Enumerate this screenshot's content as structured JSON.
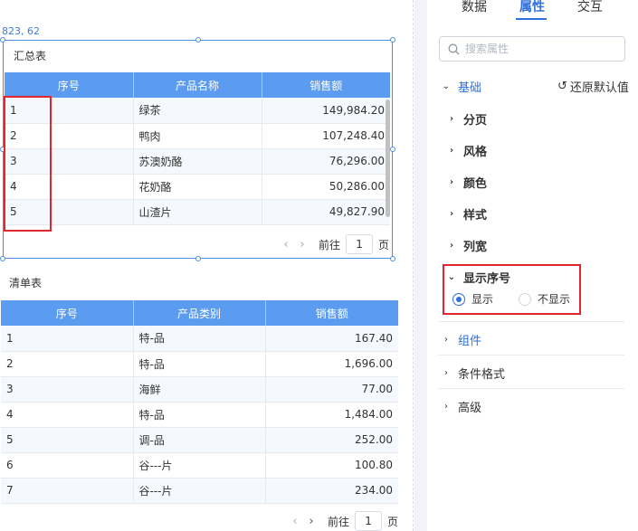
{
  "canvas": {
    "coord_readout": "823, 62",
    "summary": {
      "title": "汇总表",
      "columns": [
        "序号",
        "产品名称",
        "销售额"
      ],
      "rows": [
        [
          "1",
          "绿茶",
          "149,984.20"
        ],
        [
          "2",
          "鸭肉",
          "107,248.40"
        ],
        [
          "3",
          "苏澳奶酪",
          "76,296.00"
        ],
        [
          "4",
          "花奶酪",
          "50,286.00"
        ],
        [
          "5",
          "山渣片",
          "49,827.90"
        ]
      ],
      "pager": {
        "goto_label": "前往",
        "page": "1",
        "page_unit": "页"
      }
    },
    "detail": {
      "title": "清单表",
      "columns": [
        "序号",
        "产品类别",
        "销售额"
      ],
      "rows": [
        [
          "1",
          "特-品",
          "167.40"
        ],
        [
          "2",
          "特-品",
          "1,696.00"
        ],
        [
          "3",
          "海鲜",
          "77.00"
        ],
        [
          "4",
          "特-品",
          "1,484.00"
        ],
        [
          "5",
          "调-品",
          "252.00"
        ],
        [
          "6",
          "谷---片",
          "100.80"
        ],
        [
          "7",
          "谷---片",
          "234.00"
        ]
      ],
      "pager": {
        "goto_label": "前往",
        "page": "1",
        "page_unit": "页"
      }
    }
  },
  "panel": {
    "tabs": [
      {
        "label": "数据",
        "active": false
      },
      {
        "label": "属性",
        "active": true
      },
      {
        "label": "交互",
        "active": false
      }
    ],
    "search_placeholder": "搜索属性",
    "basic": {
      "label": "基础",
      "reset_label": "还原默认值"
    },
    "basic_items": [
      "分页",
      "风格",
      "颜色",
      "样式",
      "列宽"
    ],
    "show_index": {
      "label": "显示序号",
      "options": [
        {
          "label": "显示",
          "selected": true
        },
        {
          "label": "不显示",
          "selected": false
        }
      ]
    },
    "sections": [
      "组件",
      "条件格式",
      "高级"
    ]
  },
  "colors": {
    "accent": "#2f6fdc",
    "table_header": "#5b9bf0",
    "highlight": "#e0262e"
  },
  "icons": [
    "search-icon",
    "reset-icon",
    "chevron-right-icon",
    "chevron-down-icon",
    "chevron-left-icon"
  ]
}
